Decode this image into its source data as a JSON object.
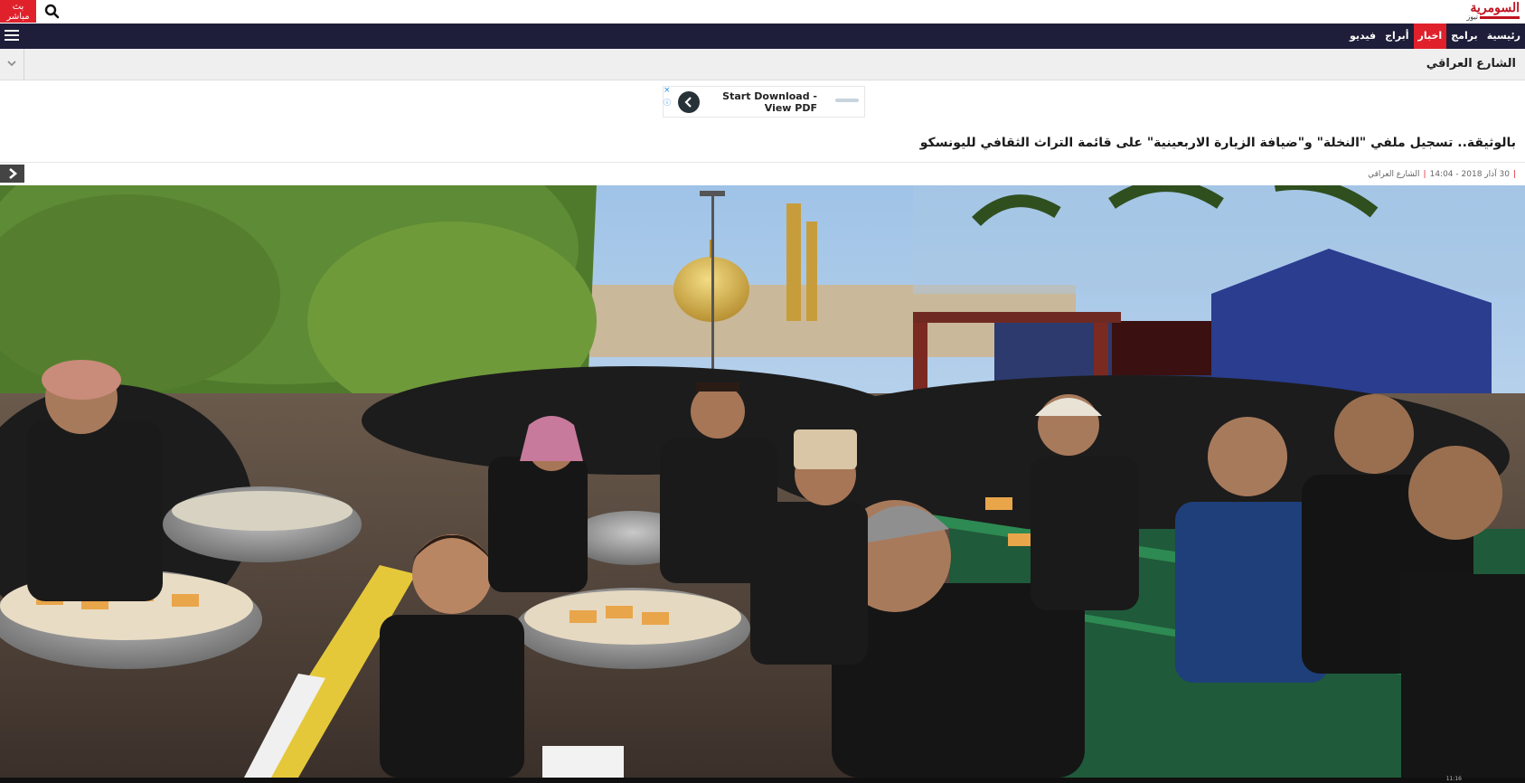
{
  "topbar": {
    "live_label": "بث مباشر",
    "search_icon": "search-icon",
    "logo_text": "السومرية",
    "logo_sub": "نيوز",
    "brand_color": "#c1121f"
  },
  "nav": {
    "items": [
      {
        "label": "رئيسية",
        "active": false
      },
      {
        "label": "برامج",
        "active": false
      },
      {
        "label": "اخبار",
        "active": true
      },
      {
        "label": "أبراج",
        "active": false
      },
      {
        "label": "فيديو",
        "active": false
      }
    ],
    "active_color": "#e0212b",
    "bar_color": "#1e1e3a"
  },
  "section": {
    "title": "الشارع العراقي"
  },
  "ad": {
    "close_label": "×",
    "info_label": "ⓘ",
    "text": "Start Download - View PDF"
  },
  "article": {
    "headline": "بالوثيقة.. تسجيل ملفي \"النخلة\" و\"ضيافة الزيارة الاربعينية\" على قائمة التراث الثقافي لليونسكو",
    "date": "30 آذار 2018 - 14:04",
    "category": "الشارع العراقي"
  },
  "taskbar": {
    "clock": "11:16"
  }
}
